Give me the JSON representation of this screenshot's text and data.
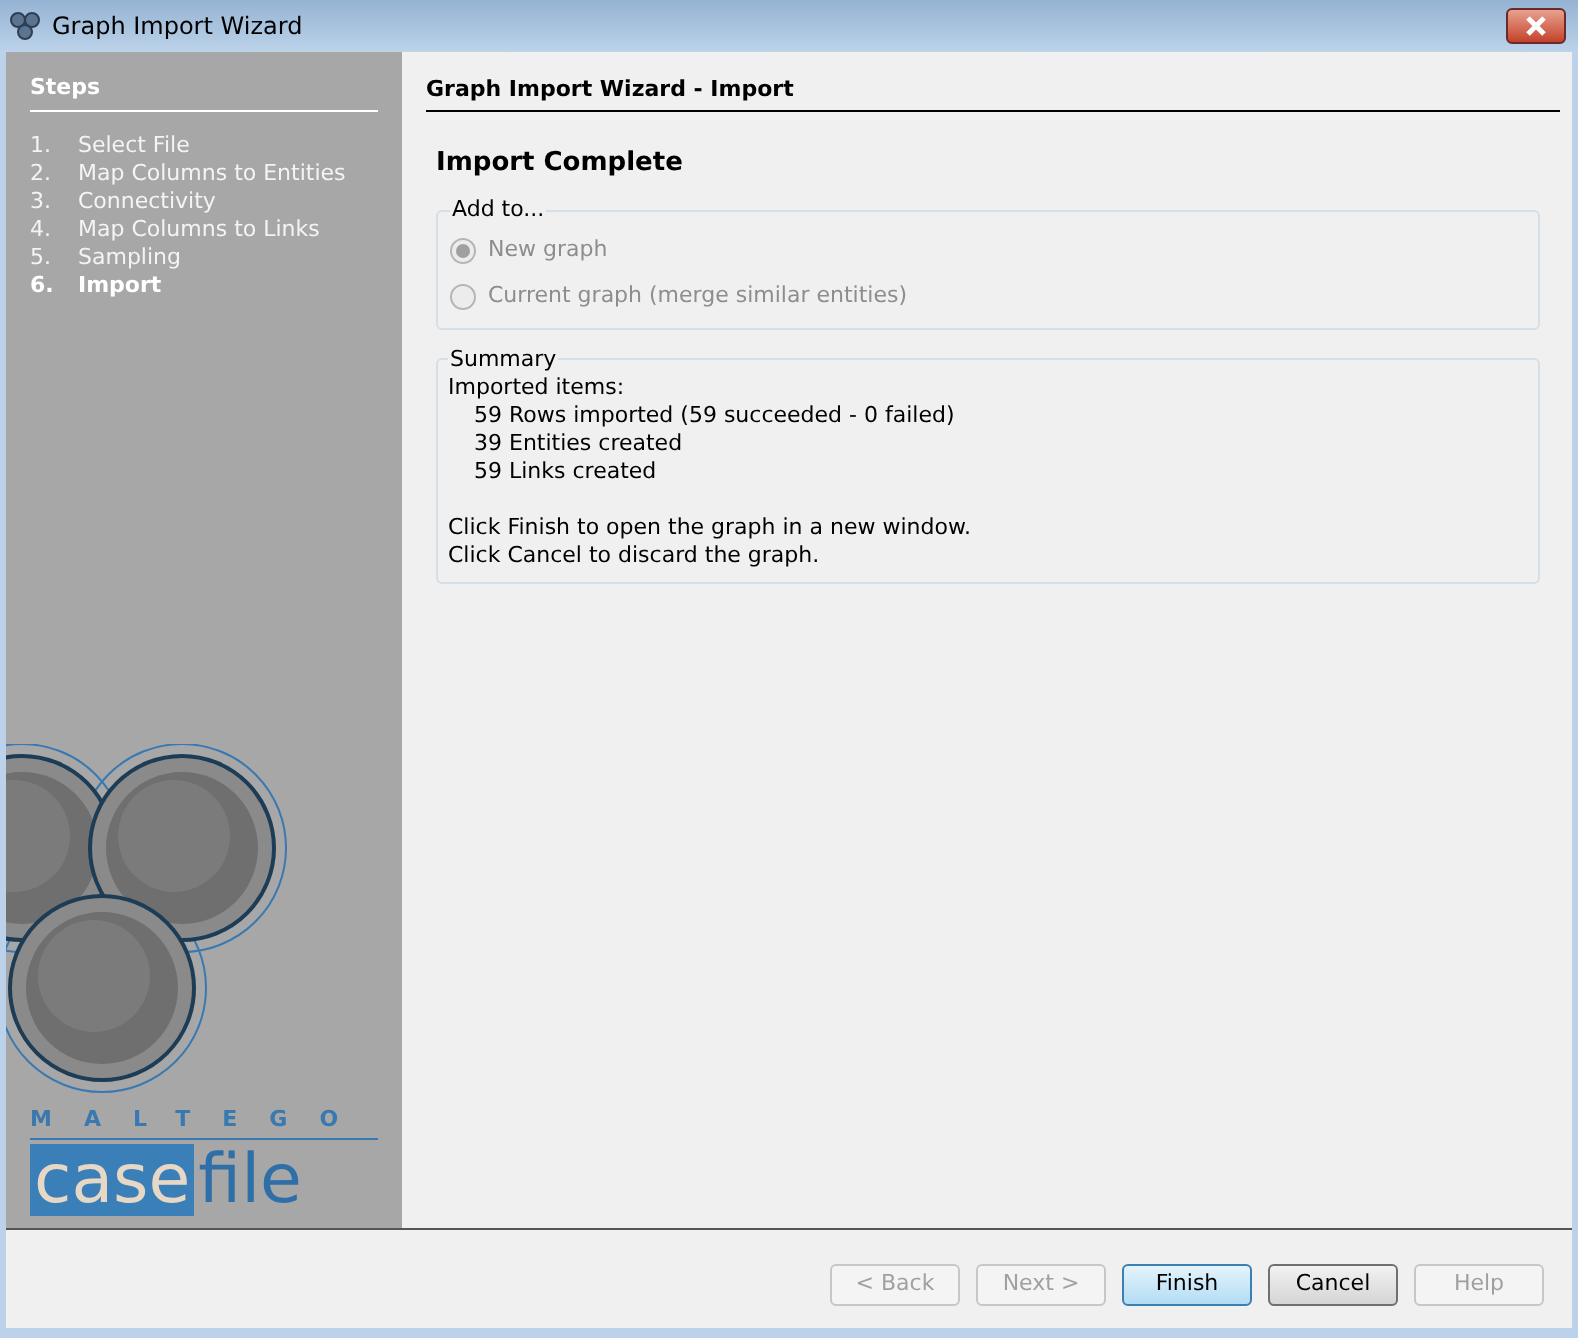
{
  "window": {
    "title": "Graph Import Wizard"
  },
  "steps": {
    "title": "Steps",
    "items": [
      {
        "number": "1.",
        "label": "Select File",
        "selected": false
      },
      {
        "number": "2.",
        "label": "Map Columns to Entities",
        "selected": false
      },
      {
        "number": "3.",
        "label": "Connectivity",
        "selected": false
      },
      {
        "number": "4.",
        "label": "Map Columns to Links",
        "selected": false
      },
      {
        "number": "5.",
        "label": "Sampling",
        "selected": false
      },
      {
        "number": "6.",
        "label": "Import",
        "selected": true
      }
    ]
  },
  "logo": {
    "brand": "MALTEGO",
    "product_part_1": "case",
    "product_part_2": "file"
  },
  "panel": {
    "title": "Graph Import Wizard - Import",
    "heading": "Import Complete"
  },
  "add_to": {
    "title": "Add to...",
    "options": [
      {
        "label": "New graph",
        "checked": true,
        "disabled": true
      },
      {
        "label": "Current graph (merge similar entities)",
        "checked": false,
        "disabled": true
      }
    ]
  },
  "summary": {
    "title": "Summary",
    "intro": "Imported items:",
    "items": [
      "59 Rows imported (59 succeeded - 0 failed)",
      "39 Entities created",
      "59 Links created"
    ],
    "notes": [
      "Click Finish to open the graph in a new window.",
      "Click Cancel to discard the graph."
    ]
  },
  "buttons": [
    {
      "label": "< Back",
      "disabled": true,
      "default": false
    },
    {
      "label": "Next >",
      "disabled": true,
      "default": false
    },
    {
      "label": "Finish",
      "disabled": false,
      "default": true
    },
    {
      "label": "Cancel",
      "disabled": false,
      "default": false
    },
    {
      "label": "Help",
      "disabled": true,
      "default": false
    }
  ]
}
